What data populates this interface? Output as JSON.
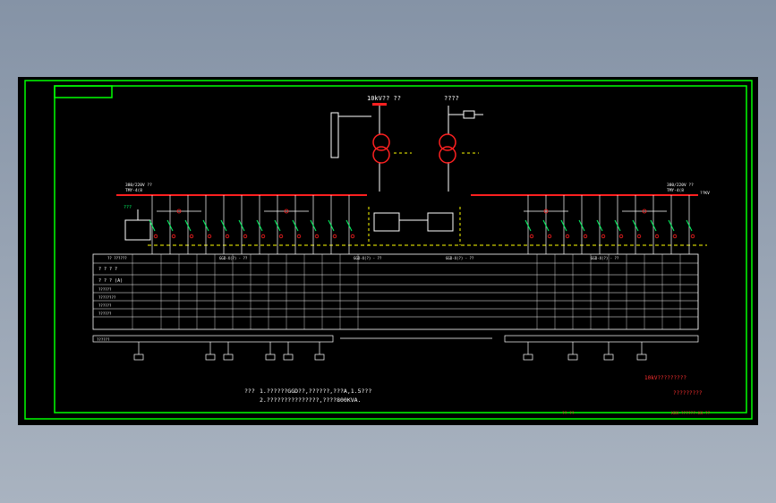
{
  "colors": {
    "frame": "#00ff00",
    "bus": "#ff2020",
    "wire": "#ffffff",
    "dash": "#ffff00",
    "label": "#00ff66",
    "note": "#ff3030"
  },
  "sources": {
    "left_title": "10kV?? ??",
    "right_title": "????"
  },
  "buses": {
    "left_label": "380/220V  ??",
    "left_sub": "TMY-4(8",
    "right_label": "380/220V  ??",
    "right_sub": "TMY-4(8",
    "right_tag": "??KV"
  },
  "table": {
    "row_headers": [
      "? ? ? ?",
      "? ? ? (A)",
      "??????",
      "????????",
      "??????",
      "??????"
    ],
    "group_headers": [
      "GGD-X(?) - ??",
      "GGD-X(?) - ??",
      "GGD-X(?) - ??",
      "GGD-X(?) - ??"
    ],
    "first_header": "?? ??????"
  },
  "bottom_row_label": "??????",
  "notes": {
    "label": "???",
    "line1": "1.??????GGD??,??????,???A,1.5???",
    "line2": "2.???????????????,????800KVA."
  },
  "titleblock": {
    "line1": "10kV?????????",
    "line2": "?????????",
    "drawing_no": "XXX-??????-XX-??",
    "sheet": "??  ??"
  }
}
